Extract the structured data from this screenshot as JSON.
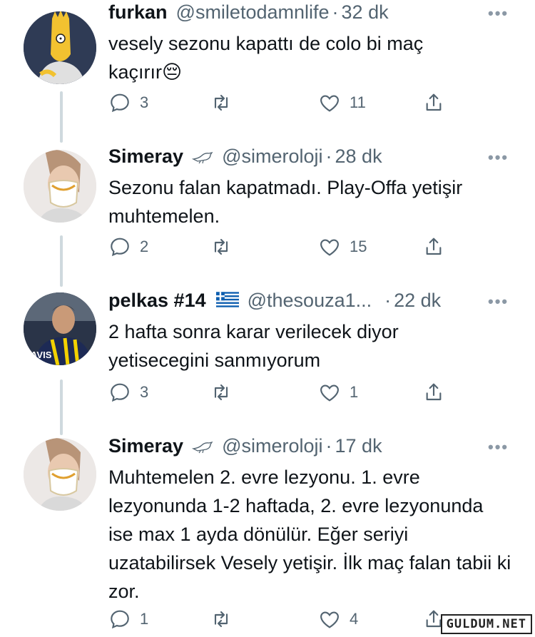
{
  "tweets": [
    {
      "name": "furkan",
      "handle": "@smiletodamnlife",
      "time": "32 dk",
      "text": "vesely sezonu kapattı de colo bi maç kaçırır😔",
      "replies": "3",
      "retweets": "",
      "likes": "11",
      "badge": "none",
      "avatar_icon": "bart-simpson-avatar-icon"
    },
    {
      "name": "Simeray",
      "handle": "@simeroloji",
      "time": "28 dk",
      "text": "Sezonu falan kapatmadı. Play-Offa yetişir muhtemelen.",
      "replies": "2",
      "retweets": "",
      "likes": "15",
      "badge": "bird-icon",
      "avatar_icon": "masked-woman-avatar-icon"
    },
    {
      "name": "pelkas #14",
      "handle": "@thesouza1...",
      "time": "22 dk",
      "text": "2 hafta sonra karar verilecek diyor yetisecegini sanmıyorum",
      "replies": "3",
      "retweets": "",
      "likes": "1",
      "badge": "greek-flag-icon",
      "avatar_icon": "footballer-avatar-icon"
    },
    {
      "name": "Simeray",
      "handle": "@simeroloji",
      "time": "17 dk",
      "text": "Muhtemelen 2. evre lezyonu. 1. evre lezyonunda 1-2 haftada, 2. evre lezyonunda ise max 1 ayda dönülür. Eğer seriyi uzatabilirsek Vesely yetişir. İlk maç falan tabii ki zor.",
      "replies": "1",
      "retweets": "",
      "likes": "4",
      "badge": "bird-icon",
      "avatar_icon": "masked-woman-avatar-icon"
    }
  ],
  "ui": {
    "separator": "·",
    "more": "•••"
  },
  "watermark": "GULDUM.NET",
  "colors": {
    "text": "#0f1419",
    "secondary": "#536471",
    "thread_line": "#cfd9de"
  }
}
